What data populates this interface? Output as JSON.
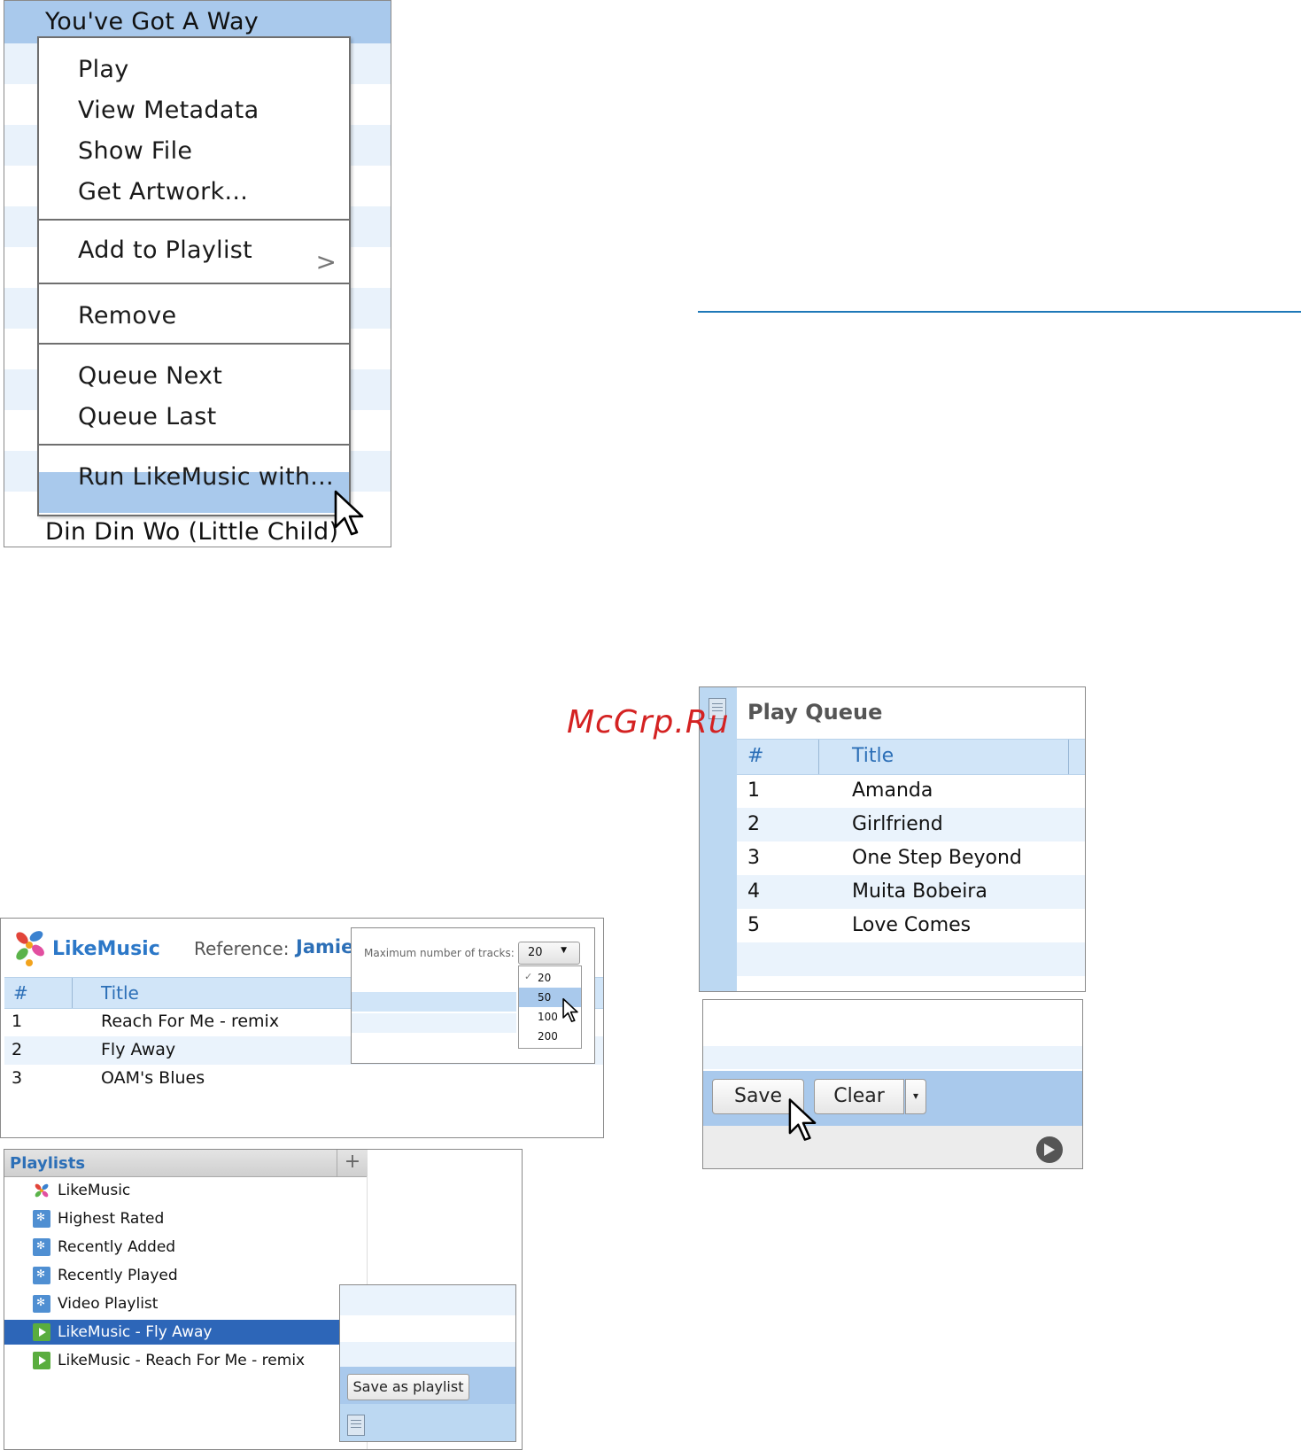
{
  "context_menu_panel": {
    "row_above": "You've Got A Way",
    "row_below": "Din Din Wo (Little Child)",
    "menu_items": [
      {
        "label": "Play"
      },
      {
        "label": "View Metadata"
      },
      {
        "label": "Show File"
      },
      {
        "label": "Get Artwork..."
      },
      {
        "label": "Add to Playlist",
        "submenu_arrow": ">"
      },
      {
        "label": "Remove"
      },
      {
        "label": "Queue Next"
      },
      {
        "label": "Queue Last"
      },
      {
        "label": "Run LikeMusic with...",
        "highlighted": true
      }
    ]
  },
  "watermark": "McGrp.Ru",
  "play_queue": {
    "title": "Play Queue",
    "columns": [
      "#",
      "Title"
    ],
    "rows": [
      {
        "num": "1",
        "title": "Amanda"
      },
      {
        "num": "2",
        "title": "Girlfriend"
      },
      {
        "num": "3",
        "title": "One Step Beyond"
      },
      {
        "num": "4",
        "title": "Muita Bobeira"
      },
      {
        "num": "5",
        "title": "Love Comes"
      }
    ]
  },
  "queue_actions": {
    "save_label": "Save",
    "clear_label": "Clear",
    "dropdown_glyph": "▾"
  },
  "likemusic_panel": {
    "brand": "LikeMusic",
    "reference_label": "Reference:",
    "reference_value": "Jamie",
    "columns": [
      "#",
      "Title"
    ],
    "rows": [
      {
        "num": "1",
        "title": "Reach For Me - remix"
      },
      {
        "num": "2",
        "title": "Fly Away"
      },
      {
        "num": "3",
        "title": "OAM's Blues"
      }
    ]
  },
  "tracks_popup": {
    "label": "Maximum number of tracks:",
    "selected": "20",
    "options": [
      "20",
      "50",
      "100",
      "200"
    ],
    "checked_option": "20",
    "hover_option": "50"
  },
  "playlists_panel": {
    "title": "Playlists",
    "add_glyph": "+",
    "items": [
      {
        "label": "LikeMusic",
        "icon": "likemusic-logo-icon"
      },
      {
        "label": "Highest Rated",
        "icon": "smart-playlist-icon"
      },
      {
        "label": "Recently Added",
        "icon": "smart-playlist-icon"
      },
      {
        "label": "Recently Played",
        "icon": "smart-playlist-icon"
      },
      {
        "label": "Video Playlist",
        "icon": "smart-playlist-icon"
      },
      {
        "label": "LikeMusic - Fly Away",
        "icon": "playlist-icon",
        "selected": true
      },
      {
        "label": "LikeMusic - Reach For Me - remix",
        "icon": "playlist-icon"
      }
    ]
  },
  "save_playlist_popup": {
    "button_label": "Save as playlist"
  },
  "colors": {
    "accent_blue": "#2c6fb7",
    "row_highlight": "#a9c9ec",
    "selected_item": "#2d66b8",
    "watermark_red": "#d42222",
    "divider_line": "#1e78b8"
  }
}
